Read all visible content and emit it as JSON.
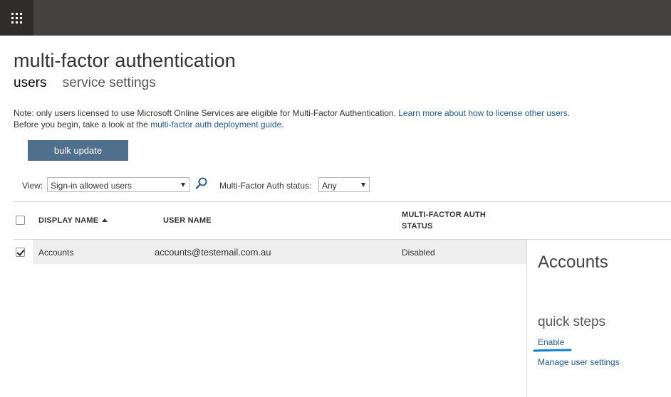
{
  "app": {
    "launcher_icon": "waffle-grid-icon",
    "title": "multi-factor authentication"
  },
  "tabs": [
    {
      "label": "users",
      "active": true
    },
    {
      "label": "service settings",
      "active": false
    }
  ],
  "note": {
    "line1_text": "Note: only users licensed to use Microsoft Online Services are eligible for Multi-Factor Authentication. ",
    "line1_link": "Learn more about how to license other users.",
    "line2_text": "Before you begin, take a look at the ",
    "line2_link": "multi-factor auth deployment guide",
    "line2_end": "."
  },
  "actions": {
    "bulk_update_label": "bulk update"
  },
  "filters": {
    "view_label": "View:",
    "view_selected": "Sign-in allowed users",
    "search_icon": "search-icon",
    "status_label": "Multi-Factor Auth status:",
    "status_selected": "Any"
  },
  "table": {
    "columns": [
      {
        "label": "DISPLAY NAME",
        "sort": "ascending"
      },
      {
        "label": "USER NAME"
      },
      {
        "label_line1": "MULTI-FACTOR AUTH",
        "label_line2": "STATUS"
      }
    ],
    "select_all_checked": false,
    "rows": [
      {
        "checked": true,
        "display_name": "Accounts",
        "user_name": "accounts@testemail.com.au",
        "status": "Disabled"
      }
    ]
  },
  "details_panel": {
    "title": "Accounts",
    "quick_steps_heading": "quick steps",
    "links": [
      "Enable",
      "Manage user settings"
    ],
    "highlight_color": "#0f7fd1"
  },
  "colors": {
    "topbar": "#444240",
    "launcher_bg": "#2f2d2b",
    "button": "#4f6f8c",
    "link": "#1e5a96",
    "row_selected": "#eeeeee"
  }
}
